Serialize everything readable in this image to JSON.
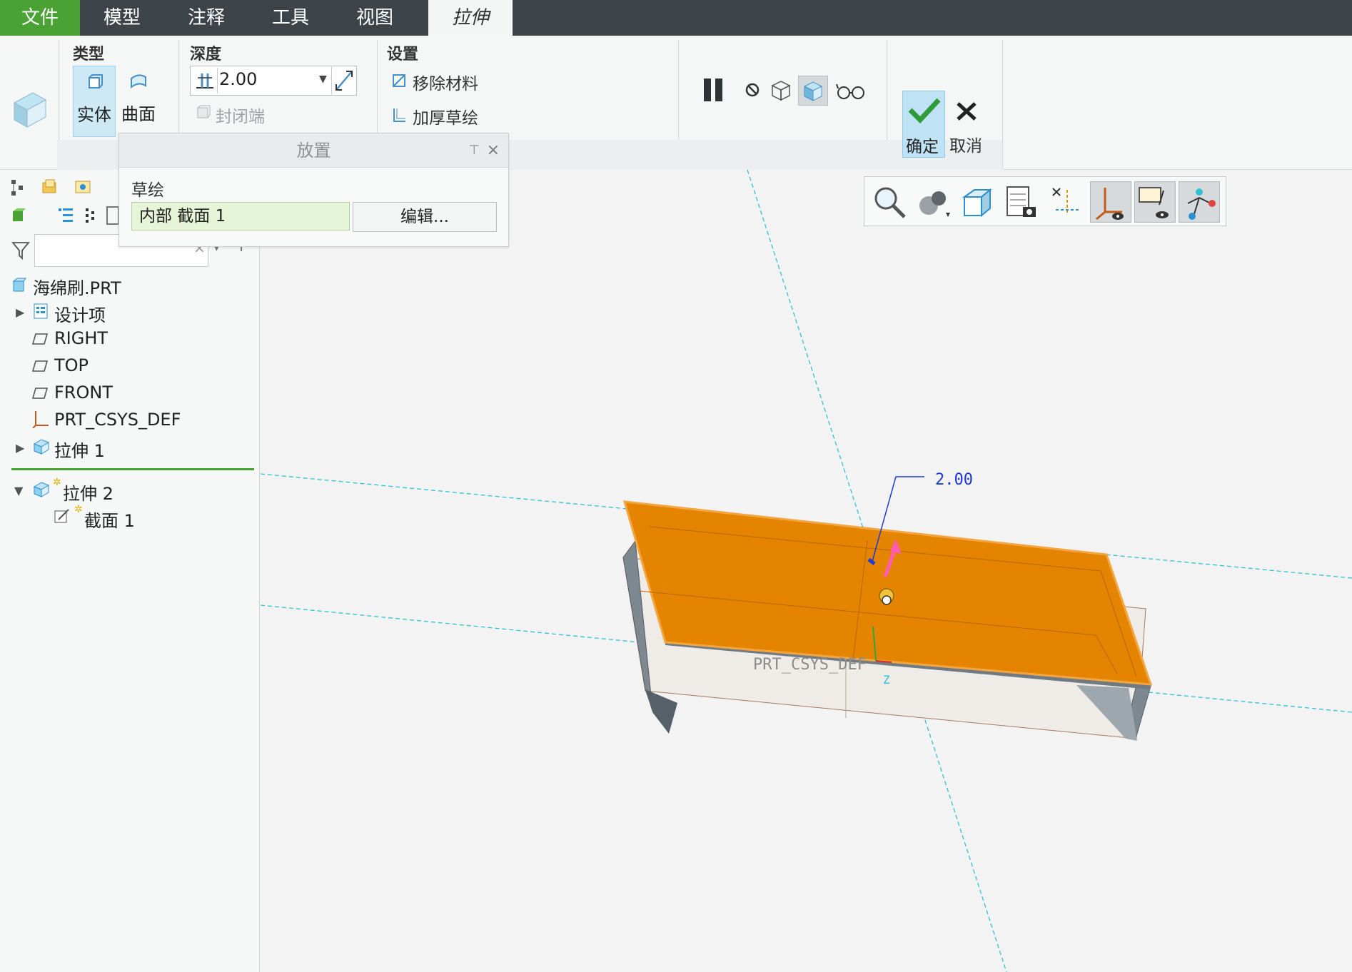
{
  "menu": {
    "file": "文件",
    "tabs": [
      "模型",
      "注释",
      "工具",
      "视图"
    ],
    "active_tab": "拉伸"
  },
  "ribbon": {
    "type_label": "类型",
    "solid_label": "实体",
    "surface_label": "曲面",
    "depth_label": "深度",
    "depth_value": "2.00",
    "capped_ends_label": "封闭端",
    "settings_label": "设置",
    "remove_material_label": "移除材料",
    "thicken_sketch_label": "加厚草绘",
    "ok_label": "确定",
    "cancel_label": "取消"
  },
  "placement_panel": {
    "title": "放置",
    "sketch_label": "草绘",
    "sketch_value": "内部 截面 1",
    "edit_button": "编辑..."
  },
  "tree": {
    "filter_placeholder": "",
    "items": [
      {
        "label": "海绵刷.PRT",
        "icon": "part-icon"
      },
      {
        "label": "设计项",
        "icon": "design-items-icon"
      },
      {
        "label": "RIGHT",
        "icon": "datum-plane-icon"
      },
      {
        "label": "TOP",
        "icon": "datum-plane-icon"
      },
      {
        "label": "FRONT",
        "icon": "datum-plane-icon"
      },
      {
        "label": "PRT_CSYS_DEF",
        "icon": "csys-icon"
      },
      {
        "label": "拉伸 1",
        "icon": "extrude-icon"
      },
      {
        "label": "拉伸 2",
        "icon": "extrude-icon"
      },
      {
        "label": "截面 1",
        "icon": "sketch-icon"
      }
    ]
  },
  "viewport": {
    "dimension_value": "2.00",
    "csys_label": "PRT_CSYS_DEF",
    "z_label": "Z",
    "colors": {
      "body_face": "#e58400",
      "edge_gray": "#7d8890",
      "datum_line": "#2ec2d4"
    }
  }
}
